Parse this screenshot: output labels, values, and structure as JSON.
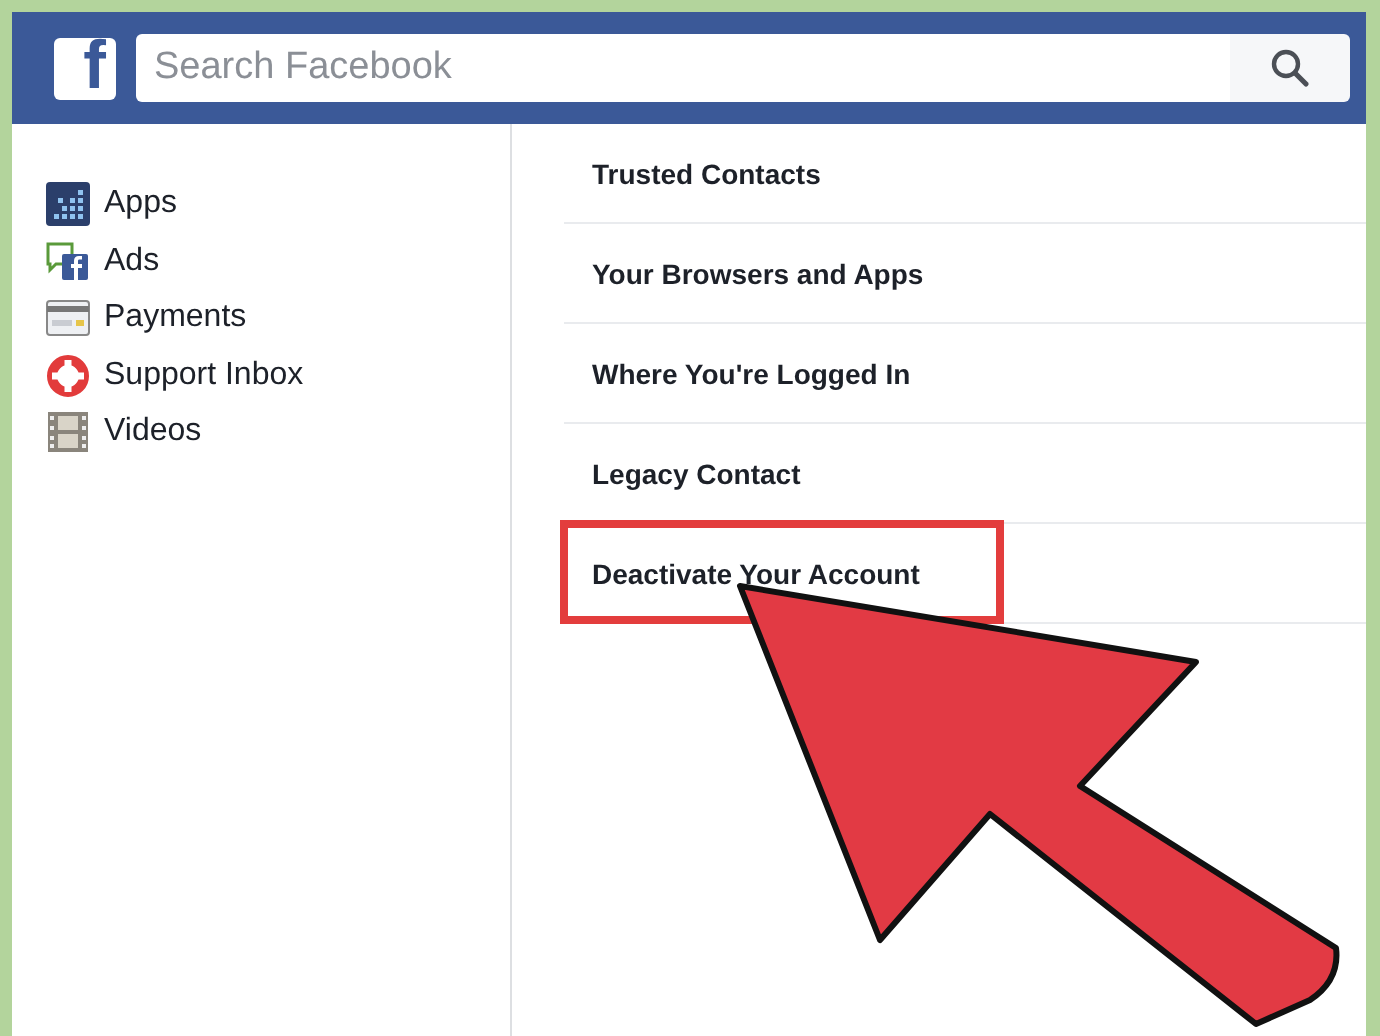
{
  "header": {
    "logo": "f",
    "search": {
      "placeholder": "Search Facebook"
    }
  },
  "sidebar": {
    "items": [
      {
        "label": "Apps"
      },
      {
        "label": "Ads"
      },
      {
        "label": "Payments"
      },
      {
        "label": "Support Inbox"
      },
      {
        "label": "Videos"
      }
    ]
  },
  "settings": {
    "rows": [
      {
        "label": "Trusted Contacts",
        "highlighted": false
      },
      {
        "label": "Your Browsers and Apps",
        "highlighted": false
      },
      {
        "label": "Where You're Logged In",
        "highlighted": false
      },
      {
        "label": "Legacy Contact",
        "highlighted": false
      },
      {
        "label": "Deactivate Your Account",
        "highlighted": true
      }
    ]
  }
}
